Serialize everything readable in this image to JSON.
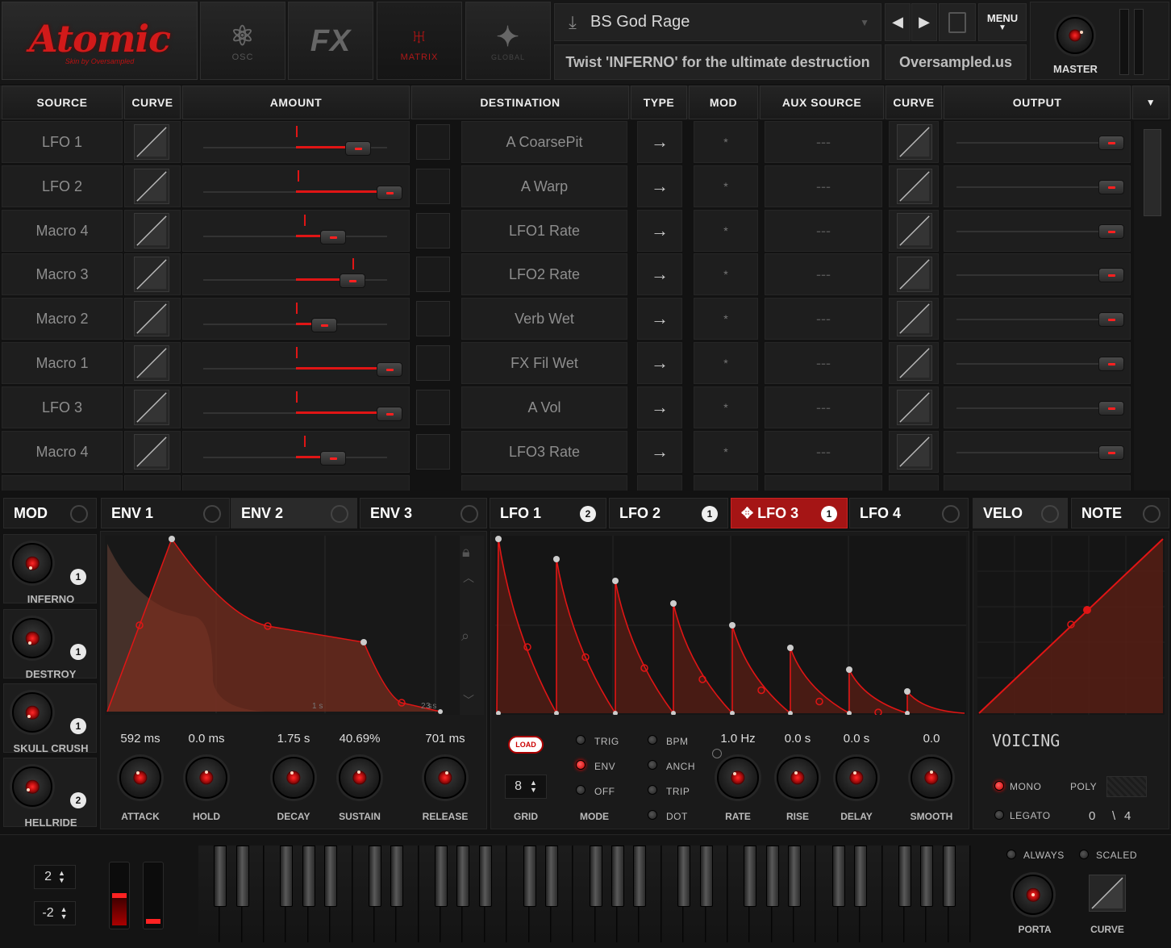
{
  "header": {
    "logo_text": "Atomic",
    "logo_subtitle": "Skin by Oversampled",
    "nav": [
      {
        "label": "OSC",
        "icon": "atom-icon"
      },
      {
        "label": "",
        "icon": "fx-icon",
        "big": "FX"
      },
      {
        "label": "MATRIX",
        "icon": "matrix-icon"
      },
      {
        "label": "GLOBAL",
        "icon": "globe-icon"
      }
    ],
    "preset_name": "BS God Rage",
    "hint": "Twist 'INFERNO' for the ultimate destruction",
    "site": "Oversampled.us",
    "menu_label": "MENU",
    "master_label": "MASTER",
    "prev_symbol": "◀",
    "next_symbol": "▶"
  },
  "matrix": {
    "columns": [
      "SOURCE",
      "CURVE",
      "AMOUNT",
      "DESTINATION",
      "TYPE",
      "MOD",
      "AUX SOURCE",
      "CURVE",
      "OUTPUT"
    ],
    "rows": [
      {
        "source": "LFO 1",
        "destination": "A CoarsePit",
        "type": "→",
        "mod": "*",
        "aux": "---",
        "amount": 0.33
      },
      {
        "source": "LFO 2",
        "destination": "A Warp",
        "type": "→",
        "mod": "*",
        "aux": "---",
        "amount": 0.5
      },
      {
        "source": "Macro 4",
        "destination": "LFO1 Rate",
        "type": "→",
        "mod": "*",
        "aux": "---",
        "amount": 0.2
      },
      {
        "source": "Macro 3",
        "destination": "LFO2 Rate",
        "type": "→",
        "mod": "*",
        "aux": "---",
        "amount": 0.3
      },
      {
        "source": "Macro 2",
        "destination": "Verb Wet",
        "type": "→",
        "mod": "*",
        "aux": "---",
        "amount": 0.15
      },
      {
        "source": "Macro 1",
        "destination": "FX Fil Wet",
        "type": "→",
        "mod": "*",
        "aux": "---",
        "amount": 0.5
      },
      {
        "source": "LFO 3",
        "destination": "A Vol",
        "type": "→",
        "mod": "*",
        "aux": "---",
        "amount": 0.5
      },
      {
        "source": "Macro 4",
        "destination": "LFO3 Rate",
        "type": "→",
        "mod": "*",
        "aux": "---",
        "amount": 0.2
      }
    ]
  },
  "tabs": {
    "mod": "MOD",
    "env": [
      "ENV 1",
      "ENV 2",
      "ENV 3"
    ],
    "lfo": [
      {
        "label": "LFO 1",
        "badge": "2"
      },
      {
        "label": "LFO 2",
        "badge": "1"
      },
      {
        "label": "LFO 3",
        "badge": "1"
      },
      {
        "label": "LFO 4",
        "badge": ""
      }
    ],
    "velo": "VELO",
    "note": "NOTE"
  },
  "macros": [
    {
      "label": "INFERNO",
      "badge": "1"
    },
    {
      "label": "DESTROY",
      "badge": "1"
    },
    {
      "label": "SKULL CRUSH",
      "badge": "1"
    },
    {
      "label": "HELLRIDE",
      "badge": "2"
    }
  ],
  "envelope": {
    "ticks": [
      "1 s",
      "2 s",
      "3 s"
    ],
    "params": [
      {
        "value": "592 ms",
        "label": "ATTACK"
      },
      {
        "value": "0.0 ms",
        "label": "HOLD"
      },
      {
        "value": "1.75 s",
        "label": "DECAY"
      },
      {
        "value": "40.69%",
        "label": "SUSTAIN"
      },
      {
        "value": "701 ms",
        "label": "RELEASE"
      }
    ]
  },
  "lfo": {
    "load": "LOAD",
    "grid_value": "8",
    "grid_label": "GRID",
    "mode_label": "MODE",
    "modes": [
      {
        "label": "TRIG",
        "on": false
      },
      {
        "label": "ENV",
        "on": true
      },
      {
        "label": "OFF",
        "on": false
      }
    ],
    "timing": [
      {
        "label": "BPM",
        "on": false
      },
      {
        "label": "ANCH",
        "on": false
      },
      {
        "label": "TRIP",
        "on": false
      },
      {
        "label": "DOT",
        "on": false
      }
    ],
    "params": [
      {
        "value": "1.0 Hz",
        "label": "RATE"
      },
      {
        "value": "0.0 s",
        "label": "RISE"
      },
      {
        "value": "0.0 s",
        "label": "DELAY"
      },
      {
        "value": "0.0",
        "label": "SMOOTH"
      }
    ]
  },
  "voicing": {
    "title": "VOICING",
    "mono": "MONO",
    "legato": "LEGATO",
    "poly": "POLY",
    "voices": "0",
    "slash": "\\",
    "max": "4"
  },
  "footer": {
    "octave_up": "2",
    "octave_down": "-2",
    "always": "ALWAYS",
    "scaled": "SCALED",
    "porta": "PORTA",
    "curve": "CURVE"
  },
  "colors": {
    "accent": "#e01515",
    "panel": "#1a1a1a"
  }
}
